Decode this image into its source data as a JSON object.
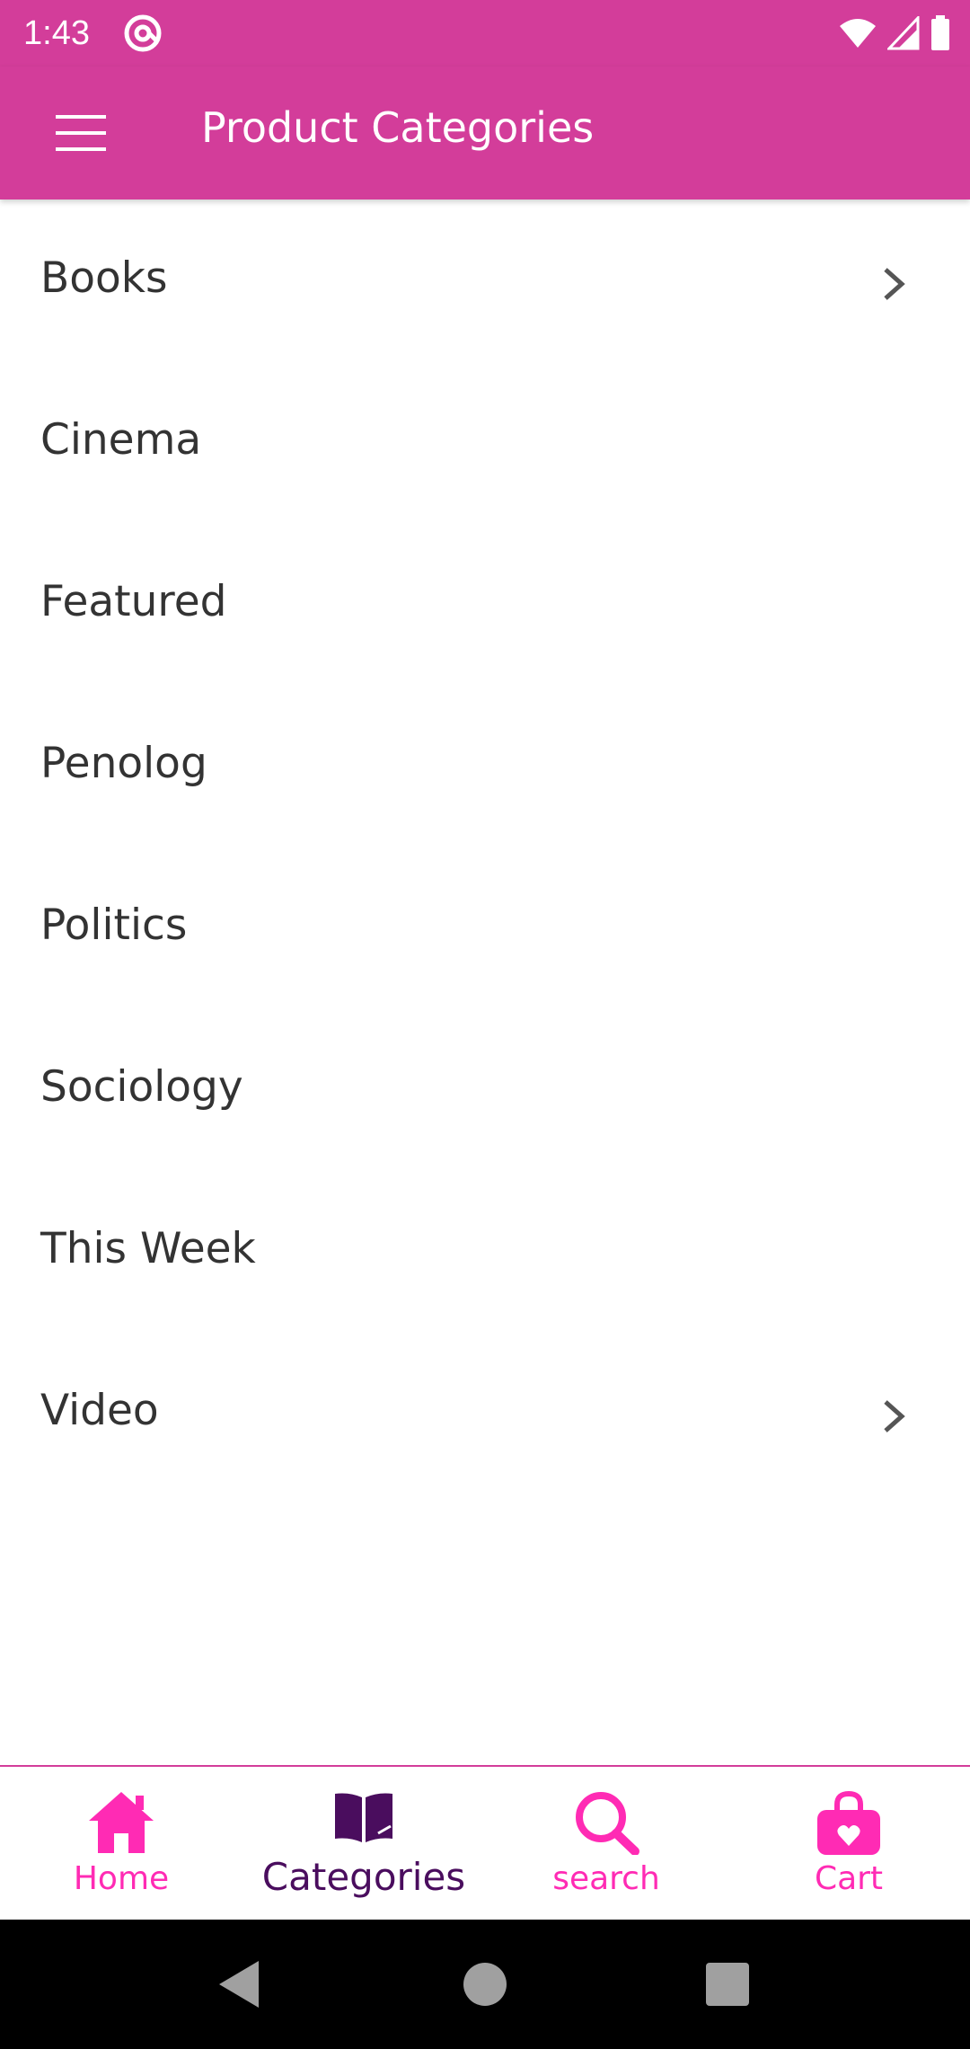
{
  "status_bar": {
    "time": "1:43",
    "app_icon": "at-circle-icon",
    "icons": [
      "wifi-icon",
      "signal-icon",
      "battery-icon"
    ]
  },
  "app_bar": {
    "title": "Product Categories",
    "menu_icon": "hamburger-menu-icon"
  },
  "categories": [
    {
      "label": "Books",
      "has_children": true
    },
    {
      "label": "Cinema",
      "has_children": false
    },
    {
      "label": "Featured",
      "has_children": false
    },
    {
      "label": "Penolog",
      "has_children": false
    },
    {
      "label": "Politics",
      "has_children": false
    },
    {
      "label": "Sociology",
      "has_children": false
    },
    {
      "label": "This Week",
      "has_children": false
    },
    {
      "label": "Video",
      "has_children": true
    }
  ],
  "bottom_nav": {
    "items": [
      {
        "label": "Home",
        "icon": "home-icon",
        "active": false
      },
      {
        "label": "Categories",
        "icon": "book-icon",
        "active": true
      },
      {
        "label": "search",
        "icon": "search-icon",
        "active": false
      },
      {
        "label": "Cart",
        "icon": "shopping-bag-icon",
        "active": false
      }
    ]
  },
  "colors": {
    "primary": "#d33d9a",
    "nav_accent": "#ff2bb4",
    "nav_active": "#4a0d5e",
    "text": "#333333"
  }
}
